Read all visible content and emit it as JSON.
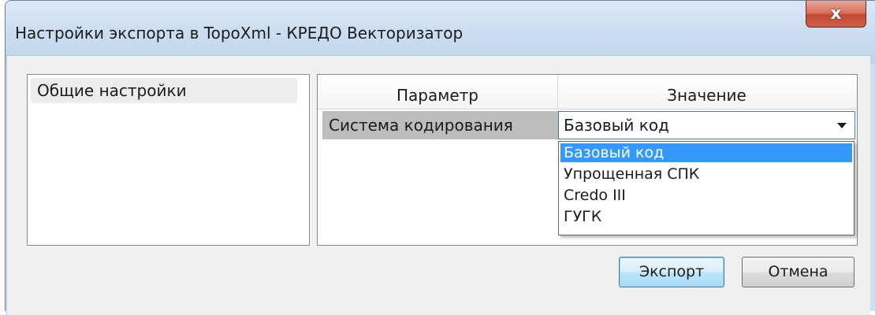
{
  "window": {
    "title": "Настройки экспорта в TopoXml - КРЕДО Векторизатор",
    "close_glyph": "x"
  },
  "sidebar": {
    "items": [
      {
        "label": "Общие настройки"
      }
    ]
  },
  "grid": {
    "columns": [
      "Параметр",
      "Значение"
    ],
    "rows": [
      {
        "parameter": "Система кодирования",
        "value": "Базовый код"
      }
    ]
  },
  "dropdown": {
    "options": [
      "Базовый код",
      "Упрощенная СПК",
      "Credo III",
      "ГУГК"
    ],
    "selected_index": 0
  },
  "buttons": {
    "export_label": "Экспорт",
    "cancel_label": "Отмена"
  },
  "colors": {
    "selection": "#3399ff",
    "close_button": "#c24a34"
  },
  "icons": {
    "close": "close-icon",
    "combo_arrow": "chevron-down-icon"
  }
}
